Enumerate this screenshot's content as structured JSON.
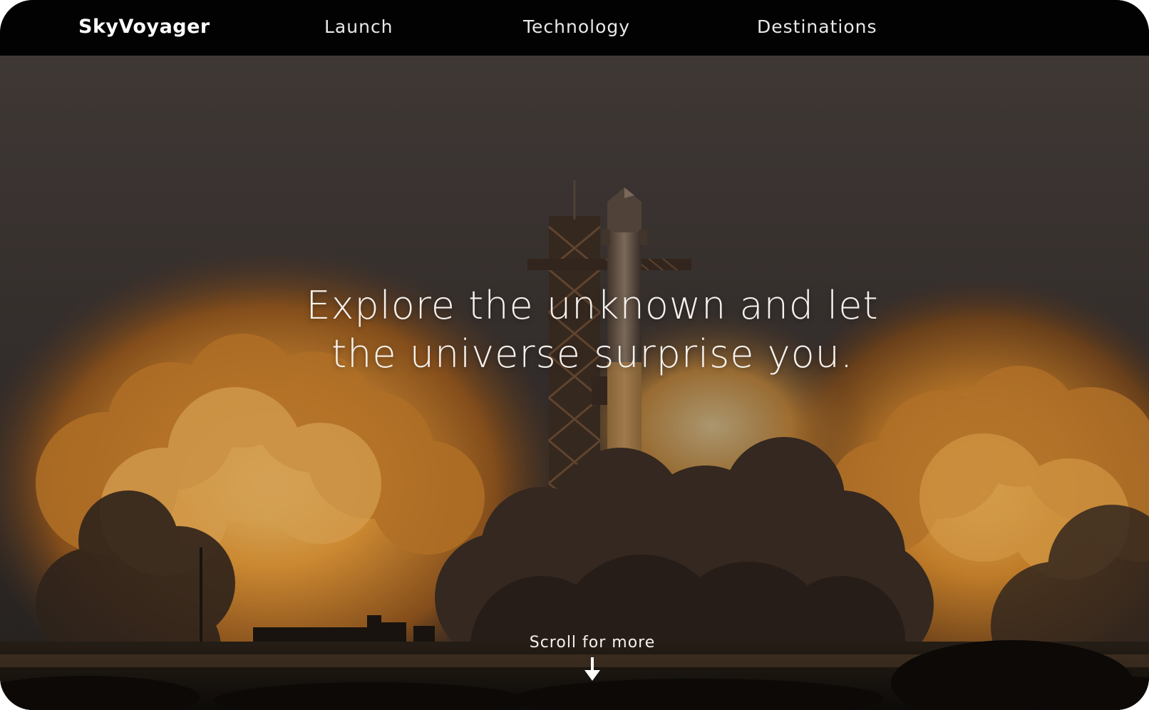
{
  "brand": {
    "name": "SkyVoyager"
  },
  "nav": {
    "items": [
      {
        "label": "Launch"
      },
      {
        "label": "Technology"
      },
      {
        "label": "Destinations"
      }
    ]
  },
  "hero": {
    "headline_line1": "Explore the unknown and let",
    "headline_line2": "the universe surprise you.",
    "scroll_label": "Scroll for more",
    "scroll_icon": "arrow-down-icon",
    "image_subject": "rocket-launch-scene"
  },
  "colors": {
    "nav_background": "#020202",
    "text": "#ffffff",
    "sky": "#3d3431",
    "fire": "#f2a33a"
  }
}
